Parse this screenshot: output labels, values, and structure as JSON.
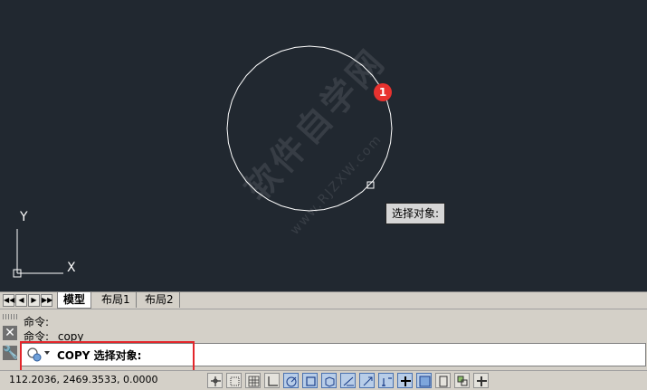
{
  "canvas": {
    "tooltip_text": "选择对象:",
    "marker_number": "1",
    "ucs_labels": {
      "x": "X",
      "y": "Y"
    },
    "watermark_text": "软件自学网",
    "watermark_url": "www.RJZXW.com",
    "background_color": "#212830",
    "marker_color": "#e8322f"
  },
  "tabs": {
    "nav_buttons": [
      "◀◀",
      "◀",
      "▶",
      "▶▶"
    ],
    "items": [
      {
        "label": "模型",
        "active": true
      },
      {
        "label": "布局1",
        "active": false
      },
      {
        "label": "布局2",
        "active": false
      }
    ]
  },
  "command": {
    "history": [
      "命令:",
      "命令:  _copy"
    ],
    "current_prompt": "COPY 选择对象:",
    "highlight_color": "#e3262b"
  },
  "status": {
    "coordinates": "112.2036,  2469.3533,  0.0000",
    "toggles": [
      {
        "name": "infer-constraints",
        "on": false
      },
      {
        "name": "snap",
        "on": false
      },
      {
        "name": "grid",
        "on": false
      },
      {
        "name": "ortho",
        "on": false
      },
      {
        "name": "polar",
        "on": true
      },
      {
        "name": "osnap",
        "on": true
      },
      {
        "name": "3d-osnap",
        "on": true
      },
      {
        "name": "otrack",
        "on": true
      },
      {
        "name": "ducs",
        "on": true
      },
      {
        "name": "dyn",
        "on": true
      },
      {
        "name": "lineweight",
        "on": true
      },
      {
        "name": "transparency",
        "on": true
      },
      {
        "name": "quick-properties",
        "on": false
      },
      {
        "name": "selection-cycling",
        "on": false
      },
      {
        "name": "annotation-monitor",
        "on": false
      }
    ]
  }
}
